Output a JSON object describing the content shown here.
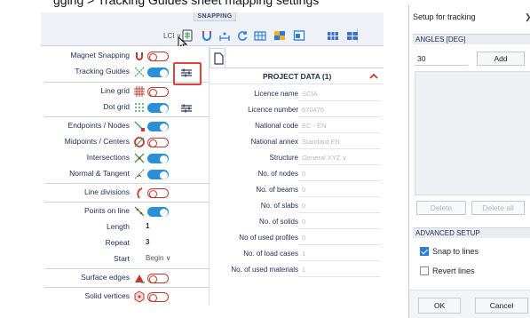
{
  "caption": "gging > Tracking Guides                              sheet mapping settings",
  "ribbon": {
    "group_title": "SNAPPING",
    "lcs_label": "LCI ∨",
    "icons": [
      "snapping-settings-icon",
      "magnet-icon",
      "line-dimension-icon",
      "refresh-icon",
      "grid-toggle-icon",
      "color-grid-icon",
      "window-icon",
      "blue-grid-icon-1",
      "blue-grid-icon-2"
    ]
  },
  "snap_panel": {
    "rows": [
      {
        "label": "Magnet Snapping",
        "icon": "magnet-icon",
        "toggle": "off"
      },
      {
        "label": "Tracking Guides",
        "icon": "tracking-icon",
        "toggle": "on",
        "settings": true
      },
      {
        "label": "Line grid",
        "icon": "line-grid-icon",
        "toggle": "off"
      },
      {
        "label": "Dot grid",
        "icon": "dot-grid-icon",
        "toggle": "on",
        "settings": true
      },
      {
        "label": "Endpoints / Nodes",
        "icon": "endpoint-icon",
        "toggle": "on"
      },
      {
        "label": "Midpoints / Centers",
        "icon": "midpoint-icon",
        "toggle": "off"
      },
      {
        "label": "Intersections",
        "icon": "intersection-icon",
        "toggle": "on"
      },
      {
        "label": "Normal & Tangent",
        "icon": "tangent-icon",
        "toggle": "on"
      },
      {
        "label": "Line divisions",
        "icon": "line-division-icon",
        "toggle": "off"
      },
      {
        "label": "Points on line",
        "icon": "points-on-line-icon",
        "toggle": "on"
      },
      {
        "label": "Length",
        "value": "1"
      },
      {
        "label": "Repeat",
        "value": "3"
      },
      {
        "label": "Start",
        "value": "Begin ∨"
      },
      {
        "label": "Surface edges",
        "icon": "surface-edge-icon",
        "toggle": "off"
      },
      {
        "label": "Solid vertices",
        "icon": "solid-vertex-icon",
        "toggle": "off"
      }
    ]
  },
  "project": {
    "title": "PROJECT DATA (1)",
    "rows": [
      {
        "key": "Licence name",
        "value": "SCIA"
      },
      {
        "key": "Licence number",
        "value": "670476"
      },
      {
        "key": "National code",
        "value": "EC - EN"
      },
      {
        "key": "National annex",
        "value": "Standard EN"
      },
      {
        "key": "Structure",
        "value": "General XYZ ∨"
      },
      {
        "key": "No. of nodes",
        "value": "0"
      },
      {
        "key": "No. of beams",
        "value": "0"
      },
      {
        "key": "No. of slabs",
        "value": "0"
      },
      {
        "key": "No. of solids",
        "value": "0"
      },
      {
        "key": "No of used profiles",
        "value": "0"
      },
      {
        "key": "No. of load cases",
        "value": "1"
      },
      {
        "key": "No. of used materials",
        "value": "1"
      }
    ]
  },
  "dialog": {
    "title": "Setup for tracking",
    "close": "❯",
    "angles_header": "ANGLES [DEG]",
    "angle_value": "30",
    "add_label": "Add",
    "delete_label": "Delete",
    "delete_all_label": "Delete all",
    "advanced_header": "ADVANCED SETUP",
    "snap_to_lines_label": "Snap to lines",
    "snap_to_lines_checked": true,
    "revert_lines_label": "Revert lines",
    "revert_lines_checked": false,
    "ok_label": "OK",
    "cancel_label": "Cancel"
  },
  "colors": {
    "toggle_on": "#2a8fd6",
    "toggle_off": "#c0392b",
    "highlight": "#e4413a",
    "label_text": "#1d2c52"
  }
}
